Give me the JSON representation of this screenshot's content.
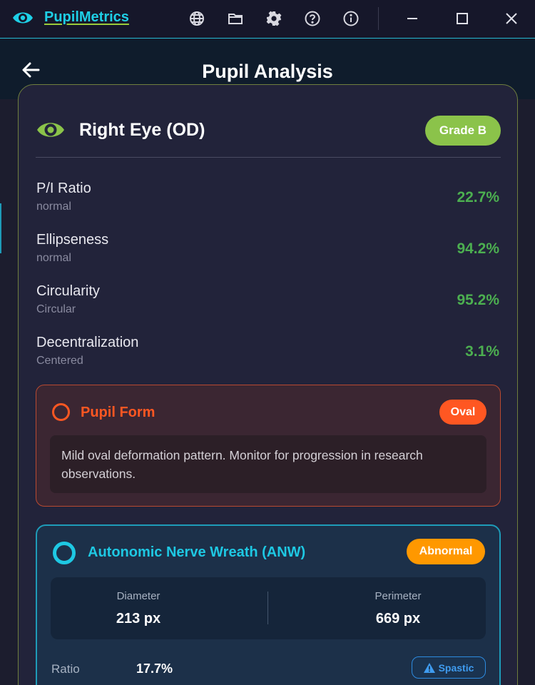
{
  "window": {
    "app_name": "PupilMetrics",
    "toolbar_icons": [
      "globe-icon",
      "folder-icon",
      "gear-icon",
      "help-icon",
      "info-icon"
    ],
    "controls": [
      "minimize",
      "maximize",
      "close"
    ]
  },
  "header": {
    "title": "Pupil Analysis"
  },
  "card": {
    "title": "Right Eye (OD)",
    "grade": "Grade B",
    "metrics": [
      {
        "name": "P/I Ratio",
        "status": "normal",
        "value": "22.7%"
      },
      {
        "name": "Ellipseness",
        "status": "normal",
        "value": "94.2%"
      },
      {
        "name": "Circularity",
        "status": "Circular",
        "value": "95.2%"
      },
      {
        "name": "Decentralization",
        "status": "Centered",
        "value": "3.1%"
      }
    ],
    "pupil_form": {
      "title": "Pupil Form",
      "badge": "Oval",
      "description": "Mild oval deformation pattern. Monitor for progression in research observations."
    },
    "anw": {
      "title": "Autonomic Nerve Wreath (ANW)",
      "badge": "Abnormal",
      "diameter_label": "Diameter",
      "diameter_value": "213 px",
      "perimeter_label": "Perimeter",
      "perimeter_value": "669 px",
      "ratio_label": "Ratio",
      "ratio_value": "17.7%",
      "type_badge": "Spastic"
    }
  },
  "colors": {
    "accent": "#1ecfe6",
    "grade": "#8bc34a",
    "good_value": "#4caf50",
    "warning": "#ff5722",
    "abnormal": "#ff9800",
    "spastic": "#3f9cf0"
  }
}
